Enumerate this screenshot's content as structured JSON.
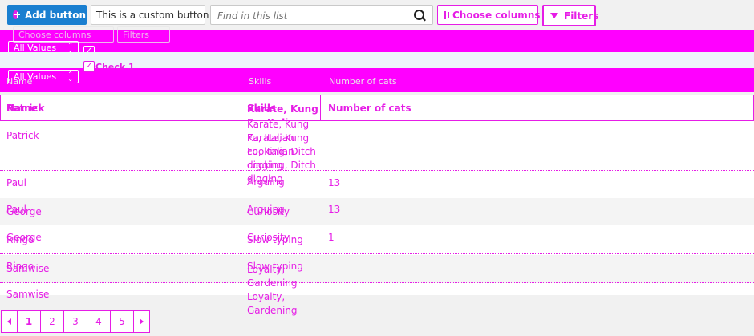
{
  "toolbar": {
    "add_label": "Add button",
    "custom_label": "This is a custom button",
    "search_placeholder": "Find in this list",
    "choose_columns_label": "Choose columns",
    "filters_label": "Filters"
  },
  "filter_bar": {
    "ghost_text": "Choose columns",
    "ghost_filters": "Filters",
    "select1_value": "All Values",
    "select2_value": "All Values",
    "check_label": "Check 1"
  },
  "columns": {
    "name": "Name",
    "skills": "Skills",
    "cats": "Number of cats"
  },
  "rows": [
    {
      "name": "Patrick",
      "skills": "Karate, Kung Fu, Italian cooking, Ditch digging",
      "cats": ""
    },
    {
      "name": "Paul",
      "skills": "Arguing",
      "cats": "13"
    },
    {
      "name": "George",
      "skills": "Curiosity",
      "cats": "1"
    },
    {
      "name": "Ringo",
      "skills": "Slow typing",
      "cats": ""
    },
    {
      "name": "Samwise",
      "skills": "Loyalty, Gardening",
      "cats": ""
    }
  ],
  "overlap_rows": [
    {
      "name": "Patrick",
      "skills": "Karate, Kung Fu, Italian cooking, Ditch digging"
    },
    {
      "name": "Paul",
      "skills": "Arguing",
      "cats": "13"
    },
    {
      "name": "George",
      "skills": "Curiosity"
    },
    {
      "name": "Ringo",
      "skills": "Slow typing"
    },
    {
      "name": "Samwise",
      "skills": "Loyalty, Gardening"
    }
  ],
  "pagination": {
    "pages": [
      "1",
      "2",
      "3",
      "4",
      "5"
    ],
    "prev_icon": "chevron-left-icon",
    "next_icon": "chevron-right-icon"
  },
  "colors": {
    "accent": "#e61de6",
    "primary": "#1a7fd0"
  }
}
